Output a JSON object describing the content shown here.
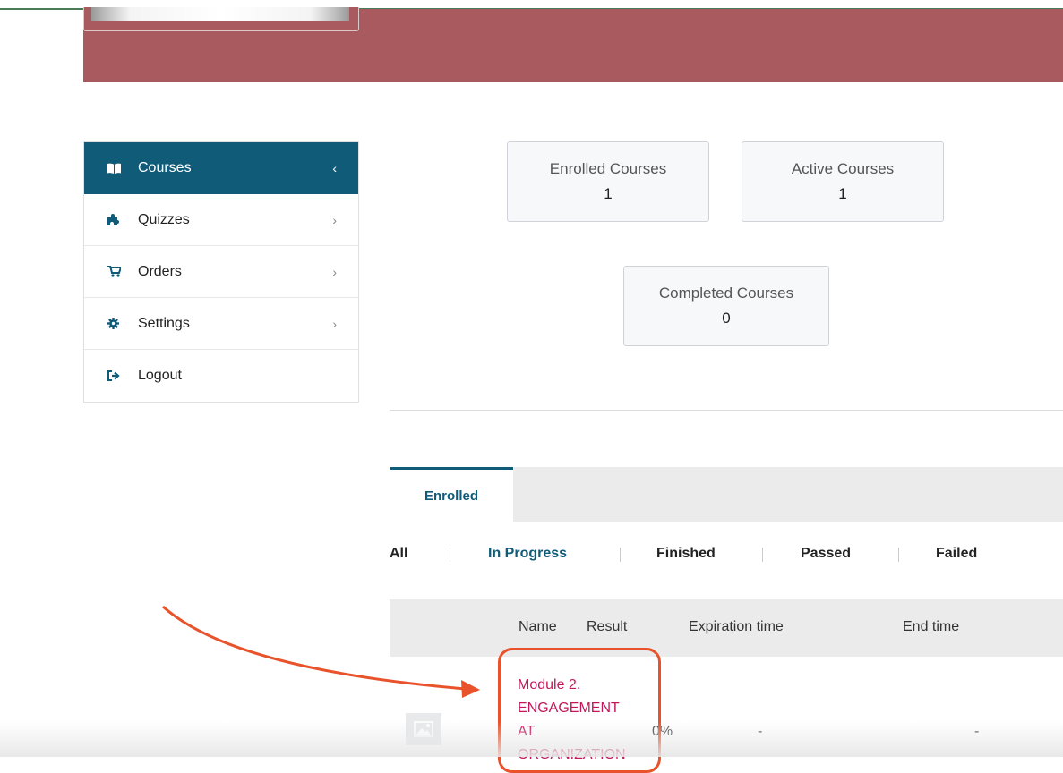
{
  "sidebar": {
    "items": [
      {
        "label": "Courses",
        "icon": "book-icon",
        "active": true
      },
      {
        "label": "Quizzes",
        "icon": "puzzle-icon",
        "active": false
      },
      {
        "label": "Orders",
        "icon": "cart-icon",
        "active": false
      },
      {
        "label": "Settings",
        "icon": "gear-icon",
        "active": false
      },
      {
        "label": "Logout",
        "icon": "logout-icon",
        "active": false
      }
    ],
    "active_chevron": "‹",
    "chevron": "›"
  },
  "stats": {
    "enrolled": {
      "title": "Enrolled Courses",
      "value": "1"
    },
    "active": {
      "title": "Active Courses",
      "value": "1"
    },
    "completed": {
      "title": "Completed Courses",
      "value": "0"
    }
  },
  "tabs": {
    "enrolled": "Enrolled"
  },
  "filters": {
    "all": "All",
    "in_progress": "In Progress",
    "finished": "Finished",
    "passed": "Passed",
    "failed": "Failed",
    "active": "In Progress"
  },
  "table": {
    "headers": {
      "name": "Name",
      "result": "Result",
      "expiration": "Expiration time",
      "end": "End time"
    },
    "rows": [
      {
        "name_lines": [
          "Module 2.",
          "ENGAGEMENT",
          "AT",
          "ORGANIZATION"
        ],
        "result": "0%",
        "expiration": "-",
        "end": "-"
      }
    ]
  },
  "colors": {
    "brand": "#0f5b78",
    "banner": "#a85a5e",
    "link": "#c2185b",
    "annotation": "#e8532b"
  }
}
